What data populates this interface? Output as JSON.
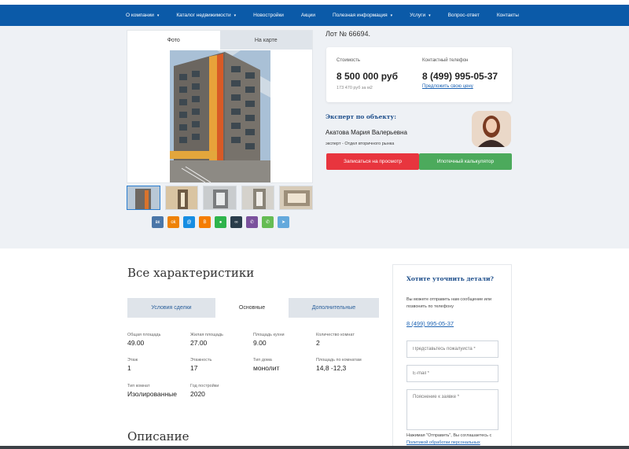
{
  "nav": {
    "items": [
      {
        "label": "О компании",
        "dropdown": true
      },
      {
        "label": "Каталог недвижимости",
        "dropdown": true
      },
      {
        "label": "Новостройки",
        "dropdown": false
      },
      {
        "label": "Акции",
        "dropdown": false
      },
      {
        "label": "Полезная информация",
        "dropdown": true
      },
      {
        "label": "Услуги",
        "dropdown": true
      },
      {
        "label": "Вопрос-ответ",
        "dropdown": false
      },
      {
        "label": "Контакты",
        "dropdown": false
      }
    ],
    "caret": "▾"
  },
  "gallery": {
    "tab_photo": "Фото",
    "tab_map": "На карте"
  },
  "share_buttons": [
    {
      "icon": "vk-icon",
      "glyph": "вк",
      "color": "#4a76a8"
    },
    {
      "icon": "odnoklassniki-icon",
      "glyph": "ok",
      "color": "#ee8208"
    },
    {
      "icon": "moimir-icon",
      "glyph": "@",
      "color": "#168de2"
    },
    {
      "icon": "blogger-icon",
      "glyph": "B",
      "color": "#f57d00"
    },
    {
      "icon": "chat-icon",
      "glyph": "●",
      "color": "#2fb44c"
    },
    {
      "icon": "link-icon",
      "glyph": "∞",
      "color": "#2a3d4b"
    },
    {
      "icon": "viber-icon",
      "glyph": "✆",
      "color": "#7b519d"
    },
    {
      "icon": "whatsapp-icon",
      "glyph": "✆",
      "color": "#65bc54"
    },
    {
      "icon": "telegram-icon",
      "glyph": "➤",
      "color": "#64a9dc"
    }
  ],
  "lot": "Лот № 66694.",
  "price": {
    "label": "Стоимость",
    "value": "8 500 000 руб",
    "per_m2": "173 470 руб за м2",
    "phone_label": "Контактный телефон",
    "phone": "8 (499) 995-05-37",
    "offer_link": "Предложить свою цену"
  },
  "expert": {
    "heading": "Эксперт по объекту:",
    "name": "Акатова Мария Валерьевна",
    "role": "эксперт - Отдел вторичного рынка"
  },
  "buttons": {
    "view": "Записаться на просмотр",
    "mortgage": "Ипотечный калькулятор"
  },
  "characteristics": {
    "heading": "Все характеристики",
    "tabs": [
      "Условия сделки",
      "Основные",
      "Дополнительные"
    ],
    "active_tab": 1,
    "items": [
      {
        "label": "Общая площадь",
        "value": "49.00"
      },
      {
        "label": "Жилая площадь",
        "value": "27.00"
      },
      {
        "label": "Площадь кухни",
        "value": "9.00"
      },
      {
        "label": "Количество комнат",
        "value": "2"
      },
      {
        "label": "Этаж",
        "value": "1"
      },
      {
        "label": "Этажность",
        "value": "17"
      },
      {
        "label": "Тип дома",
        "value": "монолит"
      },
      {
        "label": "Площадь по комнатам",
        "value": "14,8 -12,3"
      },
      {
        "label": "Тип комнат",
        "value": "Изолированные"
      },
      {
        "label": "Год постройки",
        "value": "2020"
      }
    ]
  },
  "description_heading": "Описание",
  "contact_form": {
    "heading": "Хотите уточнить детали?",
    "text": "Вы можете отправить нам сообщение или позвонить по телефону",
    "phone": "8 (499) 995-05-37",
    "name_placeholder": "Представьтесь пожалуйста *",
    "email_placeholder": "E-mail *",
    "message_placeholder": "Пояснение к заявке *",
    "legal_text": "Нажимая \"Отправить\", Вы соглашаетесь с",
    "legal_link": "Политикой обработки персональных"
  }
}
